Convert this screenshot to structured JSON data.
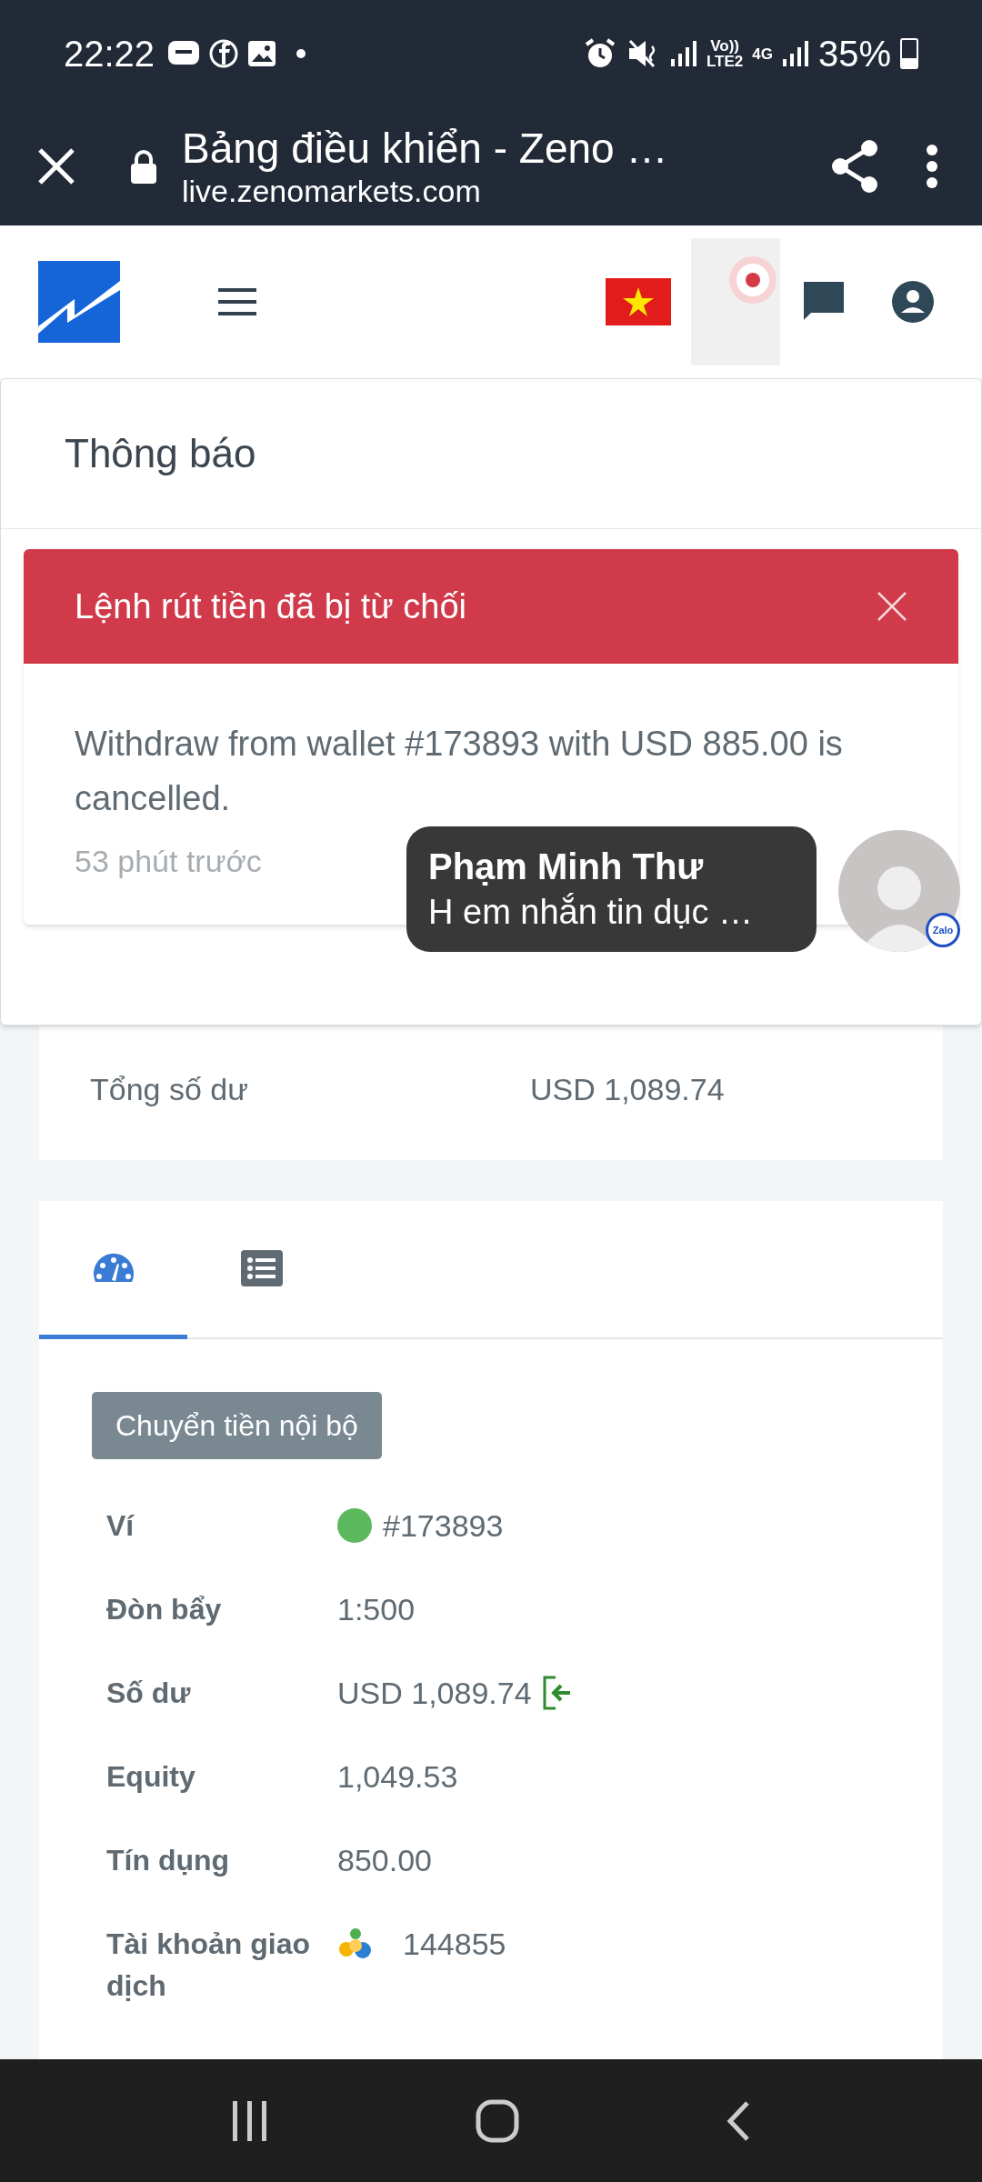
{
  "status_bar": {
    "time": "22:22",
    "network_badges": [
      "Vo))\nLTE2",
      "4G"
    ],
    "battery": "35%"
  },
  "browser_bar": {
    "title": "Bảng điều khiển - Zeno …",
    "url": "live.zenomarkets.com"
  },
  "notifications": {
    "title": "Thông báo",
    "items": [
      {
        "title": "Lệnh rút tiền đã bị từ chối",
        "message": "Withdraw from wallet #173893 with USD 885.00 is cancelled.",
        "time": "53 phút trước"
      }
    ]
  },
  "chat_bubble": {
    "name": "Phạm Minh Thư",
    "message": "H em nhắn tin dục …",
    "badge": "Zalo"
  },
  "summary": {
    "label": "Tổng số dư",
    "value": "USD 1,089.74"
  },
  "wallet_tabs": [
    {
      "kind": "dashboard",
      "selected": true
    },
    {
      "kind": "list",
      "selected": false
    }
  ],
  "transfer_button": "Chuyển tiền nội bộ",
  "wallet_rows": [
    {
      "kind": "status",
      "label": "Ví",
      "value": "#173893",
      "color": "#5cb85c"
    },
    {
      "kind": "plain",
      "label": "Đòn bẩy",
      "value": "1:500"
    },
    {
      "kind": "balance",
      "label": "Số dư",
      "value": "USD 1,089.74"
    },
    {
      "kind": "plain",
      "label": "Equity",
      "value": "1,049.53"
    },
    {
      "kind": "plain",
      "label": "Tín dụng",
      "value": "850.00"
    },
    {
      "kind": "account",
      "label": "Tài khoản giao dịch",
      "value": "144855"
    }
  ]
}
